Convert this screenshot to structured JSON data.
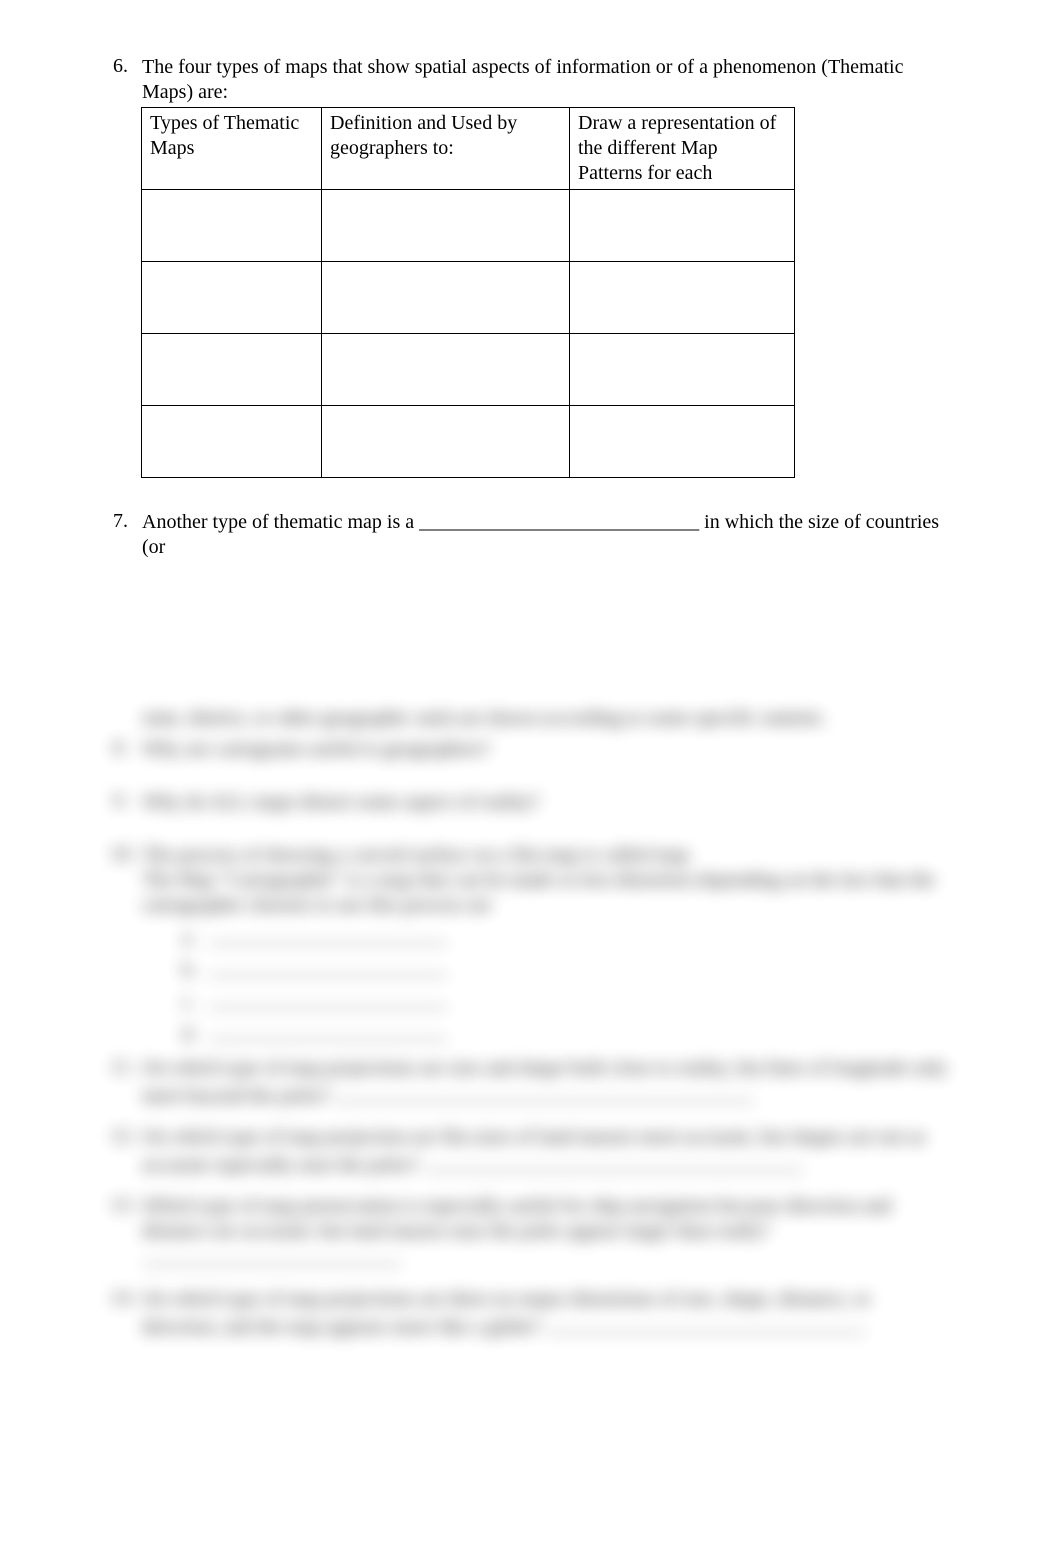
{
  "questions": {
    "q6": {
      "number": "6.",
      "text": "The four types of maps that show spatial aspects of information or of a phenomenon (Thematic Maps) are:",
      "table": {
        "headers": {
          "col1": "Types of Thematic Maps",
          "col2": "Definition and Used by geographers to:",
          "col3": "Draw a representation of the different Map Patterns for each"
        },
        "rows": [
          {
            "c1": "",
            "c2": "",
            "c3": ""
          },
          {
            "c1": "",
            "c2": "",
            "c3": ""
          },
          {
            "c1": "",
            "c2": "",
            "c3": ""
          },
          {
            "c1": "",
            "c2": "",
            "c3": ""
          }
        ]
      }
    },
    "q7": {
      "number": "7.",
      "text_a": "Another type of thematic map is a ",
      "blank": "____________________________",
      "text_b": " in which the size of countries (or"
    },
    "hidden": {
      "line_a": "state, district, or other geographic unit) are drawn according to some specific statistic.",
      "q8": {
        "number": "8.",
        "text": "Why are cartograms useful to geographers?"
      },
      "q9": {
        "number": "9.",
        "text": "Why do ALL maps distort some aspect of reality?"
      },
      "q10": {
        "number": "10.",
        "line1": "The process of showing a curved surface on a flat map is called map",
        "line2": "The Map \"Cartographer\" is a map that can be made so less distortion depending on the fact that the",
        "line3": "cartographer chooses to use this process are",
        "items": {
          "a": "a.",
          "b": "b.",
          "c": "c.",
          "d": "d."
        }
      },
      "q11": {
        "number": "11.",
        "text_a": "On which type of map projections are size and shape both close to reality, but lines of longitude only   meet beyond  the poles?",
        "blank_class": "long-line"
      },
      "q12": {
        "number": "12.",
        "text_a": "On which type of map projection are flat sizes of land masses most accurate, but shapes are not as accurate especially near the poles?",
        "blank_class": "long-line"
      },
      "q13": {
        "number": "13.",
        "text_a": "Which type of map preservation is especially useful for ship navigation because direction and distance are accurate; but land masses near the poles appear larger than really?"
      },
      "q14": {
        "number": "14.",
        "text_a": "On which type of map projections are there no major distortions of size, shape, distance, or direction; and the map appears more like a globe?",
        "blank_class": "long-line"
      }
    }
  }
}
